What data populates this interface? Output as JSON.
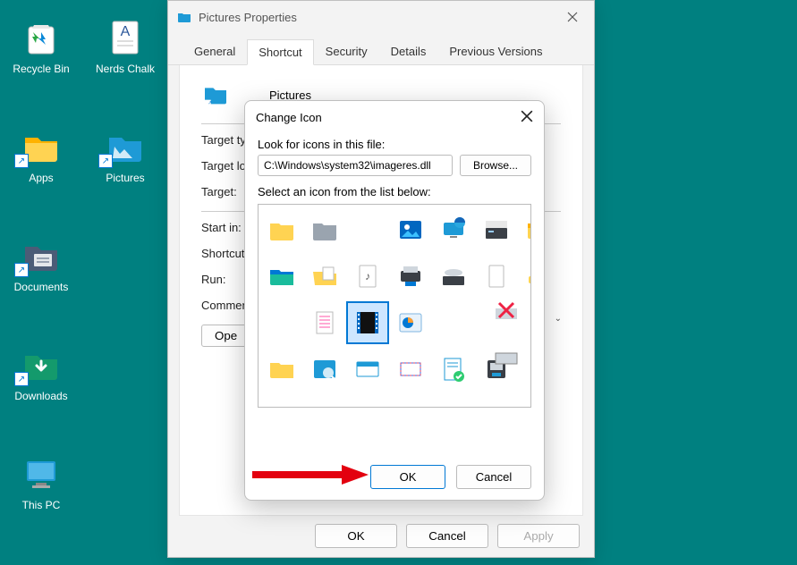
{
  "desktop": {
    "recycle": "Recycle Bin",
    "nerds": "Nerds Chalk",
    "apps": "Apps",
    "pictures": "Pictures",
    "documents": "Documents",
    "downloads": "Downloads",
    "thispc": "This PC"
  },
  "properties": {
    "title": "Pictures Properties",
    "tabs": {
      "general": "General",
      "shortcut": "Shortcut",
      "security": "Security",
      "details": "Details",
      "previous": "Previous Versions"
    },
    "name": "Pictures",
    "labels": {
      "target_type": "Target ty",
      "target_loc": "Target lo",
      "target": "Target:",
      "start_in": "Start in:",
      "shortcut_key": "Shortcut",
      "run": "Run:",
      "comments": "Commen"
    },
    "open_location": "Ope",
    "footer": {
      "ok": "OK",
      "cancel": "Cancel",
      "apply": "Apply"
    }
  },
  "change_icon": {
    "title": "Change Icon",
    "look_label": "Look for icons in this file:",
    "path": "C:\\Windows\\system32\\imageres.dll",
    "browse": "Browse...",
    "select_label": "Select an icon from the list below:",
    "ok": "OK",
    "cancel": "Cancel",
    "icons": [
      "folder-yellow",
      "folder-grey",
      "blank",
      "picture",
      "monitor-globe",
      "disk-drive",
      "folder-yellow-open",
      "folder-teal",
      "folder-open-docs",
      "music-file",
      "printer",
      "optical-drive",
      "file-blank",
      "folder-flat-yellow",
      "blank",
      "notebook",
      "film-strip",
      "pie-chart",
      "drive-x",
      "folder-yellow",
      "magnifier",
      "window",
      "mail",
      "doc-check",
      "floppy",
      "hard-drive",
      "bar-small"
    ],
    "selected_index": 16
  }
}
